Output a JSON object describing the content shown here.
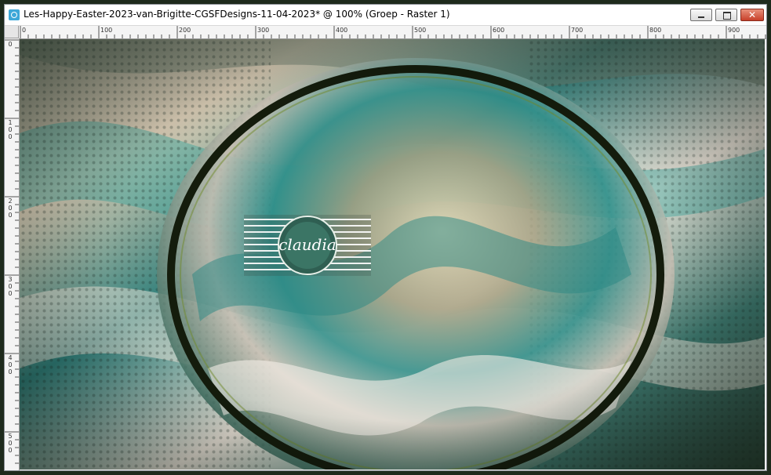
{
  "window": {
    "title": "Les-Happy-Easter-2023-van-Brigitte-CGSFDesigns-11-04-2023* @ 100% (Groep - Raster 1)",
    "minimize_icon": "minimize-icon",
    "maximize_icon": "maximize-icon",
    "close_label": "✕"
  },
  "ruler_top": [
    "0",
    "100",
    "200",
    "300",
    "400",
    "500",
    "600",
    "700",
    "800",
    "900"
  ],
  "ruler_left": [
    [
      "0"
    ],
    [
      "1",
      "0",
      "0"
    ],
    [
      "2",
      "0",
      "0"
    ],
    [
      "3",
      "0",
      "0"
    ],
    [
      "4",
      "0",
      "0"
    ],
    [
      "5",
      "0",
      "0"
    ]
  ],
  "canvas": {
    "watermark_text": "claudia",
    "colors": {
      "teal": "#2f8f8a",
      "beige": "#d9ccb5",
      "dark_green": "#1c2a12",
      "cream": "#f0ebe2"
    }
  }
}
